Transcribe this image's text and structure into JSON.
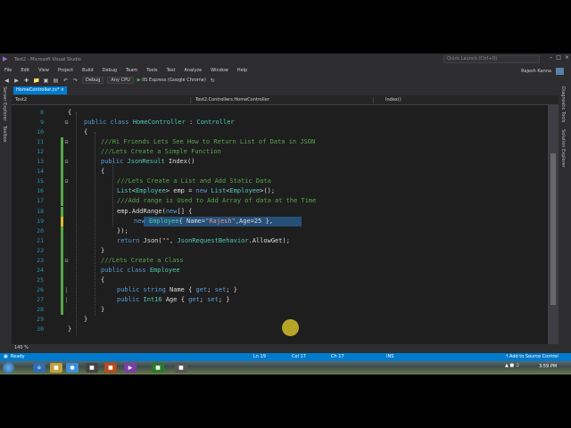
{
  "window": {
    "title": "Test2 - Microsoft Visual Studio",
    "quick_launch": "Quick Launch (Ctrl+Q)",
    "user": "Rajesh Kanna"
  },
  "menu": [
    "File",
    "Edit",
    "View",
    "Project",
    "Build",
    "Debug",
    "Team",
    "Tools",
    "Test",
    "Analyze",
    "Window",
    "Help"
  ],
  "toolbar": {
    "config": "Debug",
    "platform": "Any CPU",
    "run_target": "IIS Express (Google Chrome)"
  },
  "side_tabs": {
    "left": [
      "Server Explorer",
      "Toolbox"
    ],
    "right": [
      "Diagnostic Tools",
      "Solution Explorer"
    ]
  },
  "document_tab": {
    "label": "HomeController.cs*"
  },
  "navbar": {
    "project": "Test2",
    "class": "Test2.Controllers.HomeController",
    "member": "Index()"
  },
  "code": {
    "selected_line": "19",
    "lines": [
      {
        "n": "8",
        "text": "{"
      },
      {
        "n": "9",
        "text": "public class HomeController : Controller"
      },
      {
        "n": "10",
        "text": "{"
      },
      {
        "n": "11",
        "text": "///Hi Friends Lets See How to Return List of Data in JSON"
      },
      {
        "n": "12",
        "text": "///Lets Create a Simple Function"
      },
      {
        "n": "13",
        "text": "public JsonResult Index()"
      },
      {
        "n": "14",
        "text": "{"
      },
      {
        "n": "15",
        "text": "///Lets Create a List and Add Static Data"
      },
      {
        "n": "16",
        "text": "List<Employee> emp = new List<Employee>();"
      },
      {
        "n": "17",
        "text": "///Add range is Used to Add Array of data at the Time"
      },
      {
        "n": "18",
        "text": "emp.AddRange(new[] {"
      },
      {
        "n": "19",
        "text": "new Employee{ Name=\"Rajesh\",Age=25 },"
      },
      {
        "n": "20",
        "text": "});"
      },
      {
        "n": "21",
        "text": "return Json(\"\", JsonRequestBehavior.AllowGet);"
      },
      {
        "n": "22",
        "text": "}"
      },
      {
        "n": "23",
        "text": "///Lets Create a Class"
      },
      {
        "n": "24",
        "text": "public class Employee"
      },
      {
        "n": "25",
        "text": "{"
      },
      {
        "n": "26",
        "text": "public string Name { get; set; }"
      },
      {
        "n": "27",
        "text": "public Int16 Age { get; set; }"
      },
      {
        "n": "28",
        "text": "}"
      },
      {
        "n": "29",
        "text": "}"
      },
      {
        "n": "30",
        "text": "}"
      }
    ]
  },
  "zoom": "140 %",
  "status": {
    "state": "Ready",
    "ln": "Ln 19",
    "col": "Col 17",
    "ch": "Ch 17",
    "mode": "INS",
    "source_control": "Add to Source Control"
  },
  "taskbar": {
    "clock": "3:59 PM"
  },
  "colors": {
    "accent": "#007acc",
    "editor_bg": "#1e1e1e",
    "keyword": "#569cd6",
    "type": "#4ec9b0",
    "comment": "#57a64a",
    "string": "#d69d85",
    "selection": "#264f78"
  }
}
